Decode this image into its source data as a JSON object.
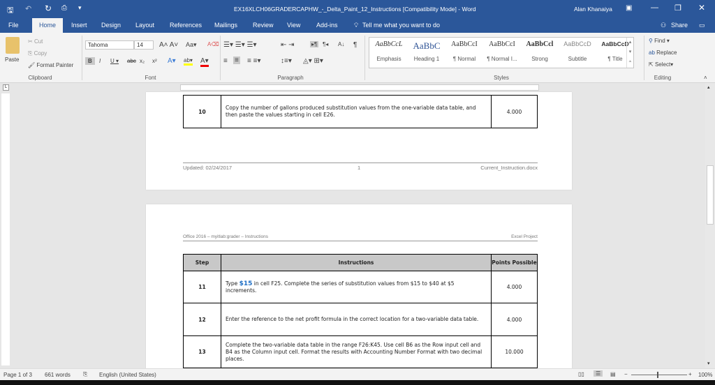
{
  "title": {
    "document": "EX16XLCH06GRADERCAPHW_-_Delta_Paint_12_Instructions [Compatibility Mode]  -  Word",
    "user": "Alan Khanaiya"
  },
  "tabs": [
    "File",
    "Home",
    "Insert",
    "Design",
    "Layout",
    "References",
    "Mailings",
    "Review",
    "View",
    "Add-ins"
  ],
  "tell_me": "Tell me what you want to do",
  "share": "Share",
  "clipboard": {
    "paste": "Paste",
    "cut": "Cut",
    "copy": "Copy",
    "format_painter": "Format Painter",
    "label": "Clipboard"
  },
  "font": {
    "name": "Tahoma",
    "size": "14",
    "label": "Font"
  },
  "paragraph": {
    "label": "Paragraph"
  },
  "styles": {
    "label": "Styles",
    "items": [
      {
        "sample": "AaBbCcL",
        "name": "Emphasis"
      },
      {
        "sample": "AaBbC",
        "name": "Heading 1"
      },
      {
        "sample": "AaBbCcI",
        "name": "¶ Normal"
      },
      {
        "sample": "AaBbCcI",
        "name": "¶ Normal I..."
      },
      {
        "sample": "AaBbCcl",
        "name": "Strong"
      },
      {
        "sample": "AaBbCcD",
        "name": "Subtitle"
      },
      {
        "sample": "AaBbCcD",
        "name": "¶ Title"
      }
    ]
  },
  "editing": {
    "find": "Find",
    "replace": "Replace",
    "select": "Select",
    "label": "Editing"
  },
  "page1": {
    "row": {
      "step": "10",
      "text": "Copy the number of gallons produced substitution values from the one-variable data table, and then paste the values starting in cell E26.",
      "points": "4.000"
    },
    "footer": {
      "updated": "Updated: 02/24/2017",
      "page": "1",
      "file": "Current_Instruction.docx"
    }
  },
  "page2": {
    "header_left": "Office 2016 – myitlab:grader – Instructions",
    "header_right": "Excel Project",
    "columns": [
      "Step",
      "Instructions",
      "Points Possible"
    ],
    "rows": [
      {
        "step": "11",
        "pre": "Type ",
        "highlight": "$15",
        "text": " in cell F25. Complete the series of substitution values from $15 to $40 at $5 increments.",
        "points": "4.000"
      },
      {
        "step": "12",
        "text": "Enter the reference to the net profit formula in the correct location for a two-variable data table.",
        "points": "4.000"
      },
      {
        "step": "13",
        "text": "Complete the two-variable data table in the range F26:K45. Use cell B6 as the Row input cell and B4 as the Column input cell. Format the results with Accounting Number Format with two decimal places.",
        "points": "10.000"
      }
    ]
  },
  "status": {
    "page": "Page 1 of 3",
    "words": "661 words",
    "language": "English (United States)",
    "zoom": "100%"
  }
}
